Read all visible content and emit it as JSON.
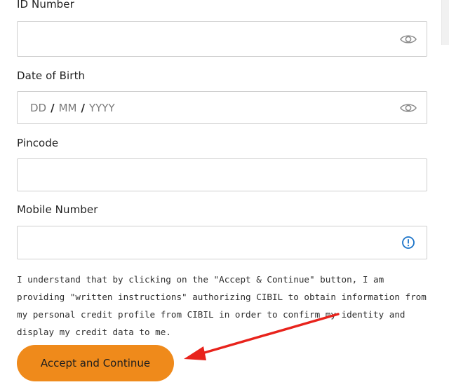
{
  "form": {
    "id_number_label": "ID Number",
    "dob_label": "Date of Birth",
    "dob_placeholder": {
      "day": "DD",
      "month": "MM",
      "year": "YYYY",
      "separator": "/"
    },
    "pincode_label": "Pincode",
    "mobile_label": "Mobile Number"
  },
  "consent": {
    "text": "I understand that by clicking on the \"Accept & Continue\" button, I am providing \"written instructions\" authorizing CIBIL to obtain information from my personal credit profile from CIBIL in order to confirm my identity and display my credit data to me."
  },
  "actions": {
    "accept_label": "Accept and Continue"
  },
  "icons": {
    "id_toggle": "eye-icon",
    "dob_toggle": "eye-icon",
    "mobile_info": "info-icon"
  },
  "colors": {
    "accent": "#ef8a1b",
    "info_icon": "#1a73c8",
    "annotation_arrow": "#e8231c"
  }
}
